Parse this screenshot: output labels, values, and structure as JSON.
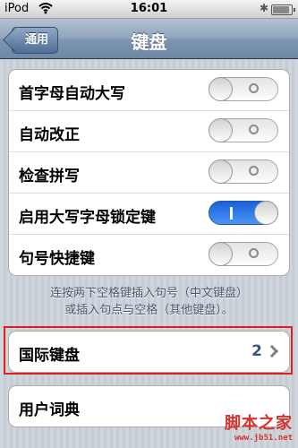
{
  "status_bar": {
    "carrier": "iPod",
    "time": "16:01",
    "bluetooth_icon": "bluetooth-icon",
    "wifi_icon": "wifi-icon",
    "battery_icon": "battery-icon"
  },
  "nav": {
    "back_label": "通用",
    "title": "键盘"
  },
  "settings": {
    "toggles": [
      {
        "label": "首字母自动大写",
        "on": false
      },
      {
        "label": "自动改正",
        "on": false
      },
      {
        "label": "检查拼写",
        "on": false
      },
      {
        "label": "启用大写字母锁定键",
        "on": true
      },
      {
        "label": "句号快捷键",
        "on": false
      }
    ],
    "note_line1": "连按两下空格键插入句号（中文键盘）",
    "note_line2": "或插入句点与空格（其他键盘）。"
  },
  "international": {
    "label": "国际键盘",
    "count": "2"
  },
  "user_dictionary": {
    "label": "用户词典"
  },
  "watermark": {
    "line1": "脚本之家",
    "line2": "www.jb51.net"
  },
  "colors": {
    "nav_bar": "#7f96b1",
    "toggle_on": "#3d86f0",
    "highlight_box": "#e02020",
    "detail_text": "#385487"
  }
}
